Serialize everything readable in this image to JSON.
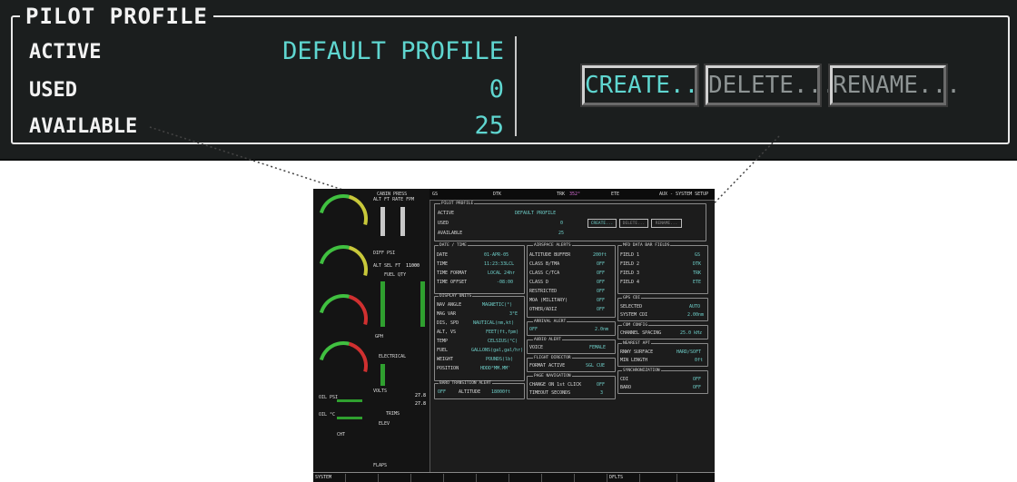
{
  "pilot_profile": {
    "title": "PILOT PROFILE",
    "rows": [
      {
        "label": "ACTIVE",
        "value": "DEFAULT PROFILE"
      },
      {
        "label": "USED",
        "value": "0"
      },
      {
        "label": "AVAILABLE",
        "value": "25"
      }
    ],
    "buttons": {
      "create": "CREATE...",
      "delete": "DELETE...",
      "rename": "RENAME..."
    }
  },
  "colors": {
    "accent_cyan": "#5fd6d0",
    "panel_bg": "#1b1e1e",
    "text_white": "#f2f2f2",
    "disabled_gray": "#8e9494"
  },
  "mfd": {
    "topbar": {
      "gs_label": "GS",
      "dtk_label": "DTK",
      "trk_label": "TRK",
      "trk_value": "352°",
      "ete_label": "ETE",
      "page_title": "AUX - SYSTEM SETUP"
    },
    "eis": {
      "oil_psi": "OIL PSI",
      "oil_c": "OIL °C",
      "cht": "CHT",
      "cabin_press": "CABIN PRESS",
      "alt_ft_rate": "ALT FT RATE FPM",
      "diff_psi": "DIFF PSI",
      "alt_sel_ft": "ALT SEL FT",
      "alt_sel_val": "11000",
      "fuel_qty": "FUEL QTY",
      "electrical": "ELECTRICAL",
      "volts": "VOLTS",
      "volts1": "27.8",
      "volts2": "27.8",
      "trims": "TRIMS",
      "elev": "ELEV",
      "flaps": "FLAPS",
      "unit_gph": "GPH"
    },
    "pilot_profile_box": {
      "title": "PILOT PROFILE",
      "active": "ACTIVE",
      "active_val": "DEFAULT PROFILE",
      "used": "USED",
      "used_val": "0",
      "available": "AVAILABLE",
      "available_val": "25",
      "create": "CREATE...",
      "delete": "DELETE...",
      "rename": "RENAME..."
    },
    "date_time": {
      "title": "DATE / TIME",
      "rows": [
        [
          "DATE",
          "01-APR-05"
        ],
        [
          "TIME",
          "11:23:33LCL"
        ],
        [
          "TIME FORMAT",
          "LOCAL 24hr"
        ],
        [
          "TIME OFFSET",
          "-08:00"
        ]
      ]
    },
    "display_units": {
      "title": "DISPLAY UNITS",
      "rows": [
        [
          "NAV ANGLE",
          "MAGNETIC(°)"
        ],
        [
          "MAG VAR",
          "3°E"
        ],
        [
          "DIS, SPD",
          "NAUTICAL(nm,kt)"
        ],
        [
          "ALT, VS",
          "FEET(ft,fpm)"
        ],
        [
          "TEMP",
          "CELSIUS(°C)"
        ],
        [
          "FUEL",
          "GALLONS(gal,gal/hr)"
        ],
        [
          "WEIGHT",
          "POUNDS(lb)"
        ],
        [
          "POSITION",
          "HDDD°MM.MM'"
        ]
      ]
    },
    "baro_transition": {
      "title": "BARO TRANSITION ALERT",
      "state": "OFF",
      "altitude": "ALTITUDE",
      "altitude_val": "18000ft"
    },
    "airspace_alerts": {
      "title": "AIRSPACE ALERTS",
      "rows": [
        [
          "ALTITUDE BUFFER",
          "200ft"
        ],
        [
          "CLASS B/TMA",
          "OFF"
        ],
        [
          "CLASS C/TCA",
          "OFF"
        ],
        [
          "CLASS D",
          "OFF"
        ],
        [
          "RESTRICTED",
          "OFF"
        ],
        [
          "MOA (MILITARY)",
          "OFF"
        ],
        [
          "OTHER/ADIZ",
          "OFF"
        ]
      ]
    },
    "arrival_alert": {
      "title": "ARRIVAL ALERT",
      "state": "OFF",
      "value": "2.0nm"
    },
    "audio_alert": {
      "title": "AUDIO ALERT",
      "label": "VOICE",
      "value": "FEMALE"
    },
    "flight_director": {
      "title": "FLIGHT DIRECTOR",
      "label": "FORMAT ACTIVE",
      "value": "SGL CUE"
    },
    "page_navigation": {
      "title": "PAGE NAVIGATION",
      "rows": [
        [
          "CHANGE ON 1st CLICK",
          "OFF"
        ],
        [
          "TIMEOUT SECONDS",
          "3"
        ]
      ]
    },
    "mfd_data_bar": {
      "title": "MFD DATA BAR FIELDS",
      "rows": [
        [
          "FIELD 1",
          "GS"
        ],
        [
          "FIELD 2",
          "DTK"
        ],
        [
          "FIELD 3",
          "TRK"
        ],
        [
          "FIELD 4",
          "ETE"
        ]
      ]
    },
    "gps_cdi": {
      "title": "GPS CDI",
      "rows": [
        [
          "SELECTED",
          "AUTO"
        ],
        [
          "SYSTEM CDI",
          "2.00nm"
        ]
      ]
    },
    "com_config": {
      "title": "COM CONFIG",
      "label": "CHANNEL SPACING",
      "value": "25.0 kHz"
    },
    "nearest_apt": {
      "title": "NEAREST APT",
      "rows": [
        [
          "RNWY SURFACE",
          "HARD/SOFT"
        ],
        [
          "MIN LENGTH",
          "0ft"
        ]
      ]
    },
    "synchronization": {
      "title": "SYNCHRONIZATION",
      "rows": [
        [
          "CDI",
          "OFF"
        ],
        [
          "BARO",
          "OFF"
        ]
      ]
    },
    "softkeys": {
      "system": "SYSTEM",
      "defaults": "DFLTS"
    }
  }
}
